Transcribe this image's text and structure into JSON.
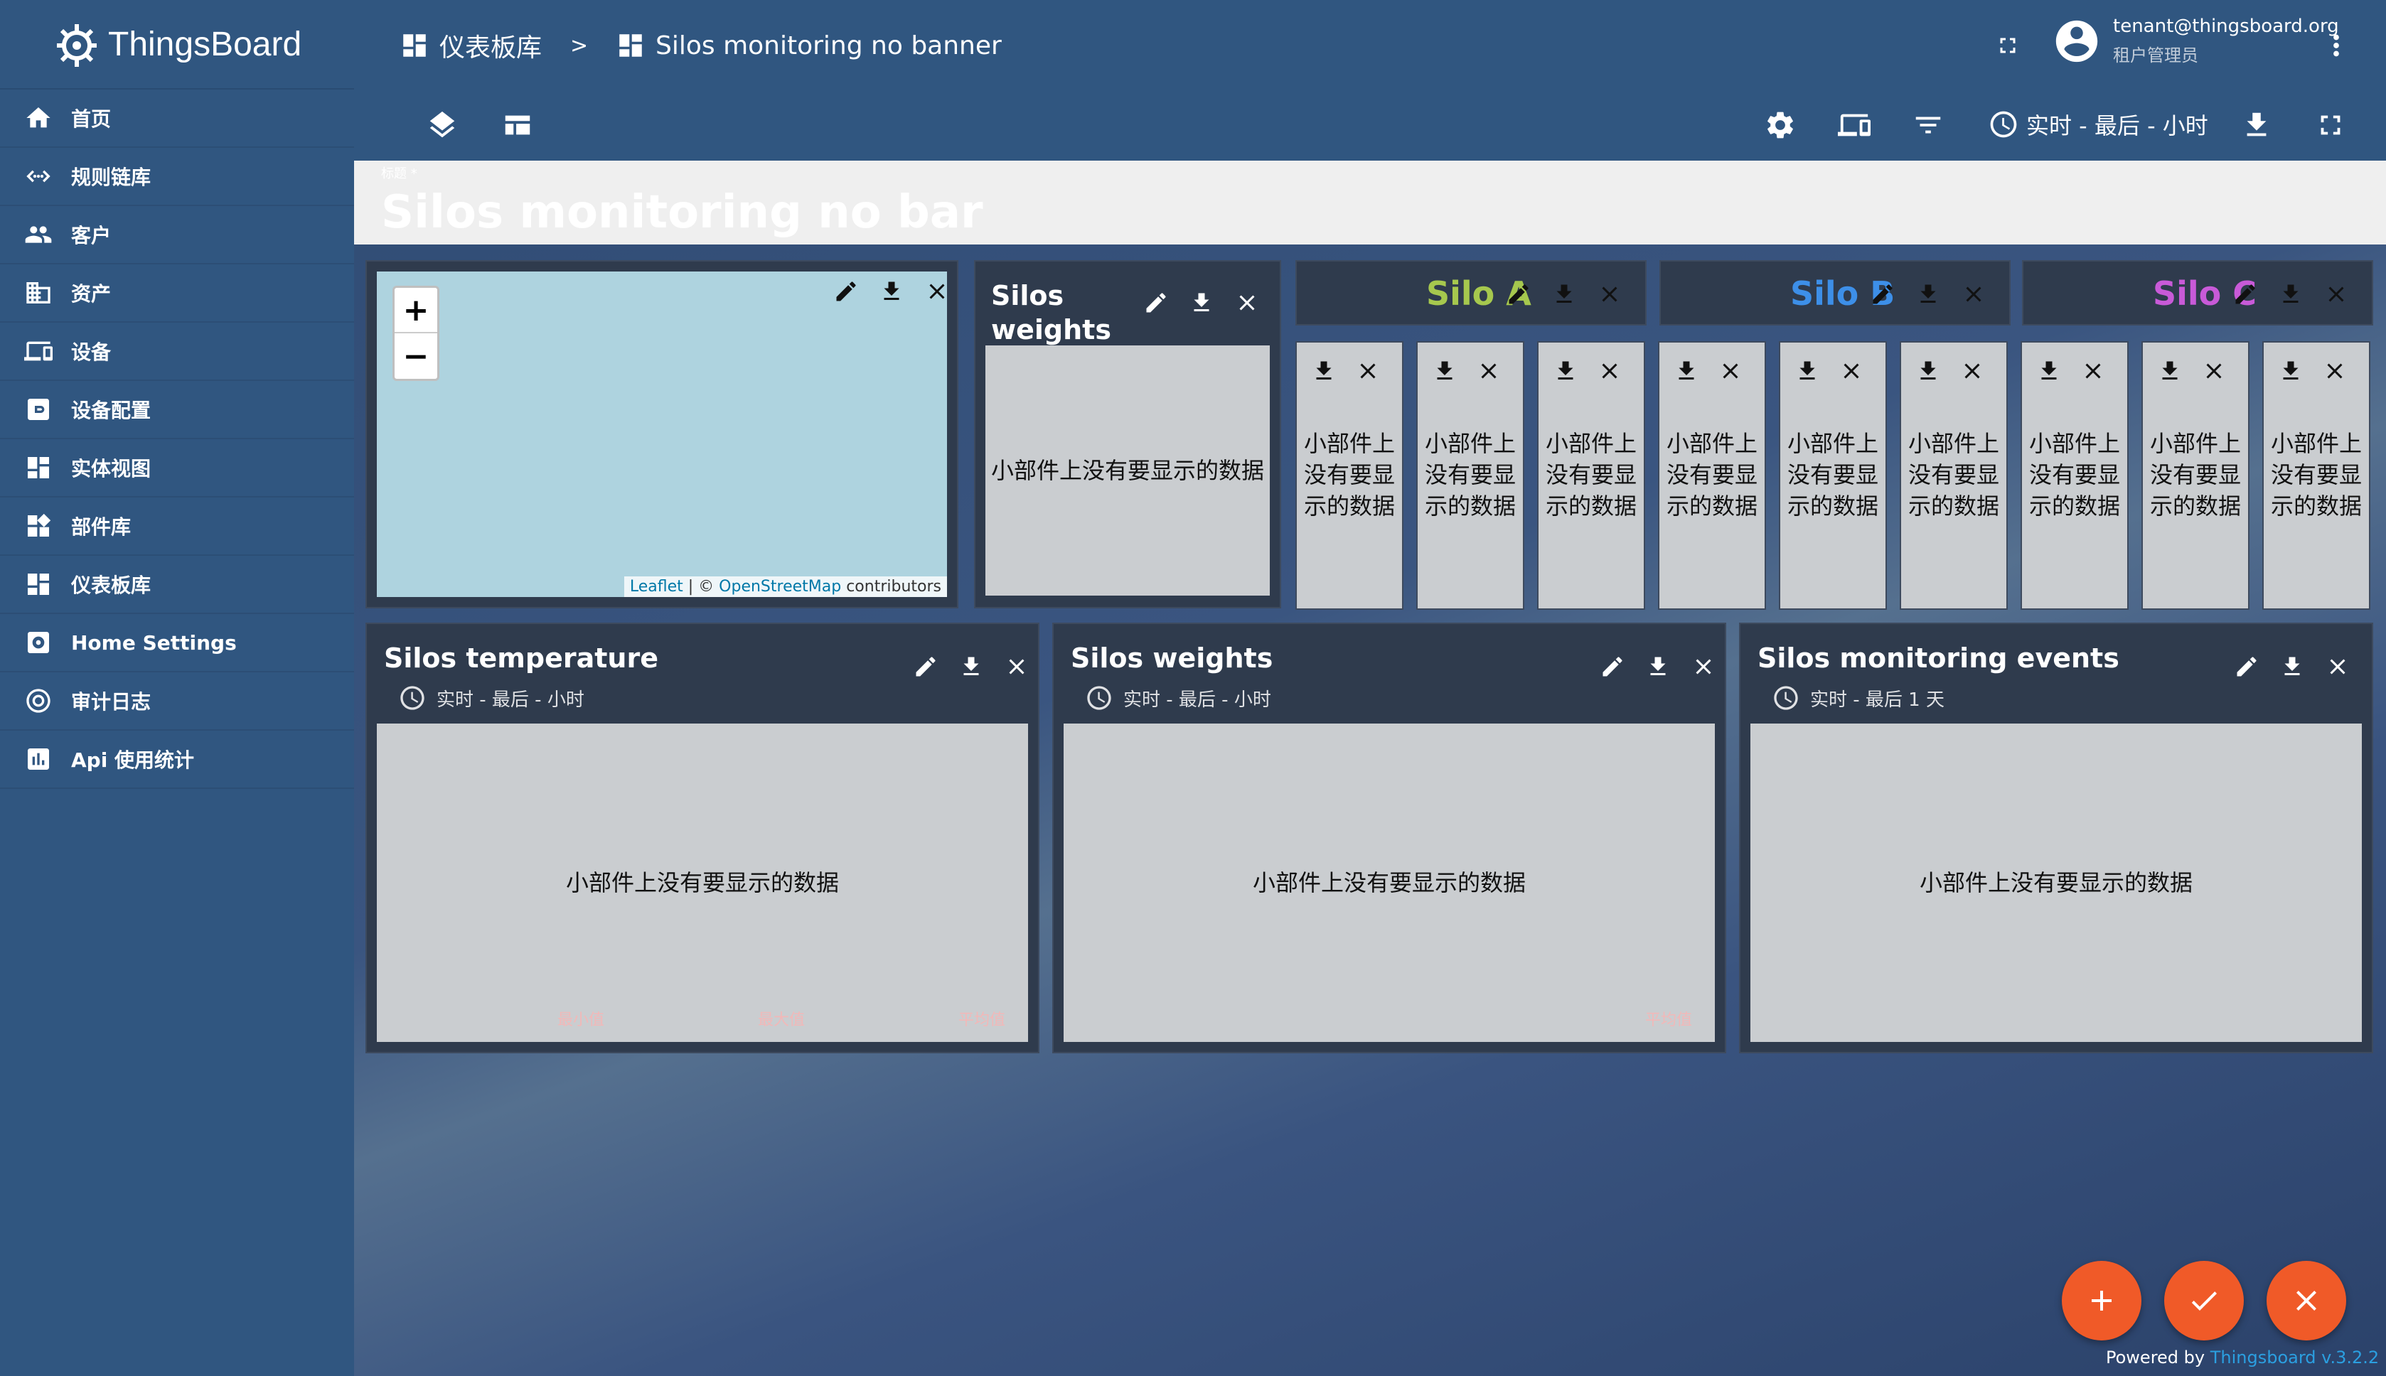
{
  "sidebar": {
    "brand": "ThingsBoard",
    "items": [
      {
        "label": "首页",
        "icon": "home-icon"
      },
      {
        "label": "规则链库",
        "icon": "rule-chain-icon"
      },
      {
        "label": "客户",
        "icon": "customers-icon"
      },
      {
        "label": "资产",
        "icon": "assets-icon"
      },
      {
        "label": "设备",
        "icon": "devices-icon"
      },
      {
        "label": "设备配置",
        "icon": "device-profile-icon"
      },
      {
        "label": "实体视图",
        "icon": "entity-view-icon"
      },
      {
        "label": "部件库",
        "icon": "widgets-icon"
      },
      {
        "label": "仪表板库",
        "icon": "dashboards-icon"
      },
      {
        "label": "Home Settings",
        "icon": "home-settings-icon"
      },
      {
        "label": "审计日志",
        "icon": "audit-log-icon"
      },
      {
        "label": "Api 使用统计",
        "icon": "api-usage-icon"
      }
    ]
  },
  "header": {
    "breadcrumb_root": "仪表板库",
    "breadcrumb_sep": ">",
    "breadcrumb_current": "Silos monitoring no banner",
    "user_email": "tenant@thingsboard.org",
    "user_role": "租户管理员",
    "timewindow": "实时 - 最后 - 小时"
  },
  "dashboard": {
    "title": "Silos monitoring no bar",
    "title_small": "标题 *"
  },
  "widgets": {
    "no_data": "小部件上没有要显示的数据",
    "map": {
      "zoom_in": "+",
      "zoom_out": "−",
      "attribution_leaflet": "Leaflet",
      "attribution_sep": " | © ",
      "attribution_osm": "OpenStreetMap",
      "attribution_tail": " contributors"
    },
    "silos_weights_small": {
      "title_line1": "Silos",
      "title_line2": "weights"
    },
    "silo_a": {
      "title": "Silo A",
      "color": "#a6c84e"
    },
    "silo_b": {
      "title": "Silo B",
      "color": "#3d8fe8"
    },
    "silo_c": {
      "title": "Silo C",
      "color": "#c85ad8"
    },
    "temperature": {
      "title": "Silos temperature",
      "time": "实时 - 最后 - 小时",
      "legend": [
        "最小值",
        "最大值",
        "平均值"
      ]
    },
    "weights": {
      "title": "Silos weights",
      "time": "实时 - 最后 - 小时",
      "legend": [
        "平均值"
      ]
    },
    "events": {
      "title": "Silos monitoring events",
      "time": "实时 - 最后 1 天"
    }
  },
  "footer": {
    "powered_by": "Powered by ",
    "brand": "Thingsboard v.3.2.2"
  },
  "colors": {
    "sidebar": "#305680",
    "accent": "#f05a28",
    "widget_bg": "#2f3b4d"
  }
}
